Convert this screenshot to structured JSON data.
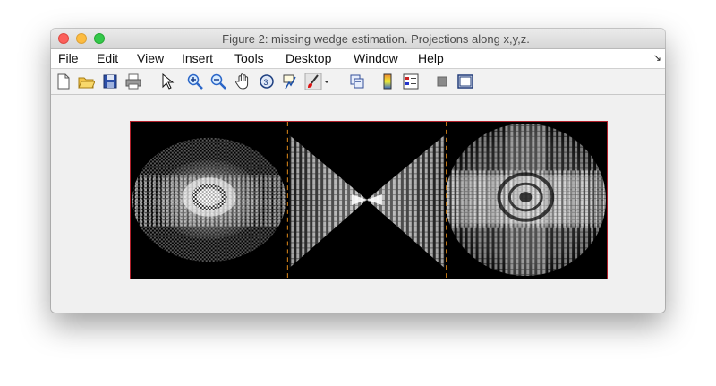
{
  "window": {
    "title": "Figure 2: missing wedge estimation. Projections along x,y,z."
  },
  "menu": {
    "items": [
      "File",
      "Edit",
      "View",
      "Insert",
      "Tools",
      "Desktop",
      "Window",
      "Help"
    ]
  },
  "toolbar": {
    "icons": [
      "new-figure-icon",
      "open-file-icon",
      "save-icon",
      "print-icon",
      "pointer-icon",
      "zoom-in-icon",
      "zoom-out-icon",
      "pan-hand-icon",
      "rotate-3d-icon",
      "data-cursor-icon",
      "brush-icon",
      "brush-dropdown-icon",
      "link-plot-icon",
      "colorbar-icon",
      "legend-icon",
      "hide-plot-tools-icon",
      "show-plot-tools-icon"
    ]
  },
  "figure": {
    "panels": [
      "projection-x",
      "projection-y",
      "projection-z"
    ],
    "frame_color": "#b0202a",
    "divider_color": "#e08a1a"
  }
}
